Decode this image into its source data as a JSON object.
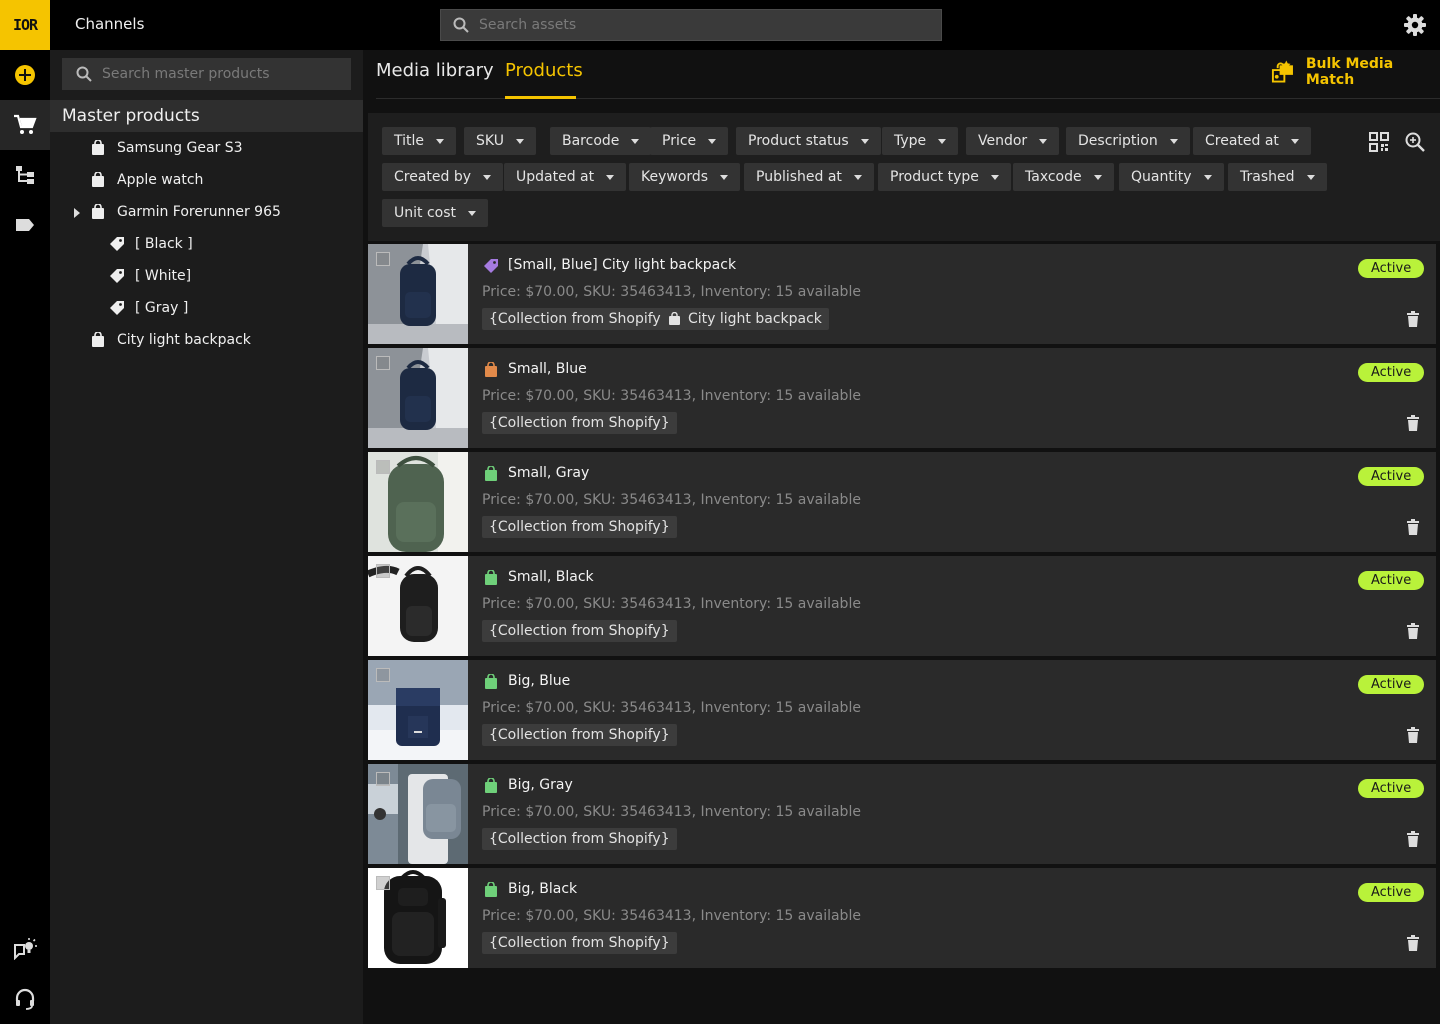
{
  "app": {
    "logo_text": "IOR",
    "channels_label": "Channels",
    "search_assets_placeholder": "Search assets"
  },
  "sidebar": {
    "search_placeholder": "Search master products",
    "header": "Master products",
    "items": [
      {
        "label": "Samsung Gear S3",
        "icon": "bag-icon"
      },
      {
        "label": "Apple watch",
        "icon": "bag-icon"
      },
      {
        "label": "Garmin Forerunner 965",
        "icon": "bag-icon"
      },
      {
        "label": "[ Black ]",
        "icon": "tag-icon"
      },
      {
        "label": "[ White]",
        "icon": "tag-icon"
      },
      {
        "label": "[ Gray ]",
        "icon": "tag-icon"
      },
      {
        "label": "City light backpack",
        "icon": "bag-icon"
      }
    ]
  },
  "tabs": [
    {
      "label": "Media library"
    },
    {
      "label": "Products",
      "active": true
    }
  ],
  "bulk_media_match_label": "Bulk Media Match",
  "filters": [
    "Title",
    "SKU",
    "Barcode",
    "Price",
    "Product status",
    "Type",
    "Vendor",
    "Description",
    "Created at",
    "Created by",
    "Updated at",
    "Keywords",
    "Published at",
    "Product type",
    "Taxcode",
    "Quantity",
    "Trashed",
    "Unit cost"
  ],
  "products": [
    {
      "title": "[Small, Blue] City light backpack",
      "icon": "tag-icon",
      "icon_color": "#a57be0",
      "meta": "Price: $70.00, SKU: 35463413, Inventory: 15 available",
      "tags": [
        "{Collection from Shopify}",
        "City light backpack"
      ],
      "status": "Active"
    },
    {
      "title": "Small, Blue",
      "icon": "bag-icon",
      "icon_color": "#e28a4a",
      "meta": "Price: $70.00, SKU: 35463413, Inventory: 15 available",
      "tags": [
        "{Collection from Shopify}"
      ],
      "status": "Active"
    },
    {
      "title": "Small, Gray",
      "icon": "bag-icon",
      "icon_color": "#6fd07a",
      "meta": "Price: $70.00, SKU: 35463413, Inventory: 15 available",
      "tags": [
        "{Collection from Shopify}"
      ],
      "status": "Active"
    },
    {
      "title": "Small, Black",
      "icon": "bag-icon",
      "icon_color": "#6fd07a",
      "meta": "Price: $70.00, SKU: 35463413, Inventory: 15 available",
      "tags": [
        "{Collection from Shopify}"
      ],
      "status": "Active"
    },
    {
      "title": "Big, Blue",
      "icon": "bag-icon",
      "icon_color": "#6fd07a",
      "meta": "Price: $70.00, SKU: 35463413, Inventory: 15 available",
      "tags": [
        "{Collection from Shopify}"
      ],
      "status": "Active"
    },
    {
      "title": "Big, Gray",
      "icon": "bag-icon",
      "icon_color": "#6fd07a",
      "meta": "Price: $70.00, SKU: 35463413, Inventory: 15 available",
      "tags": [
        "{Collection from Shopify}"
      ],
      "status": "Active"
    },
    {
      "title": "Big, Black",
      "icon": "bag-icon",
      "icon_color": "#6fd07a",
      "meta": "Price: $70.00, SKU: 35463413, Inventory: 15 available",
      "tags": [
        "{Collection from Shopify}"
      ],
      "status": "Active"
    }
  ],
  "colors": {
    "accent": "#f5c400",
    "status_active": "#b9f23a"
  }
}
